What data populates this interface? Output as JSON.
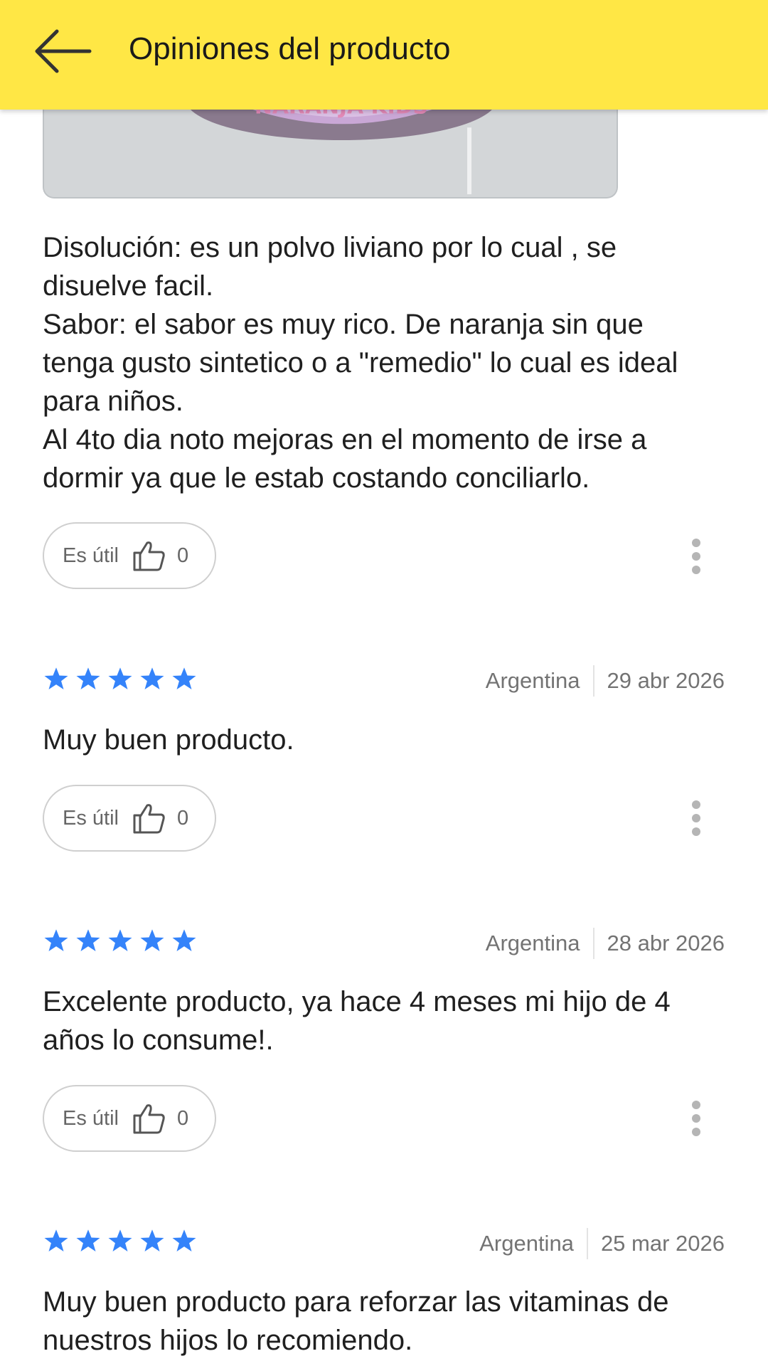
{
  "header": {
    "title": "Opiniones del producto",
    "back_icon": "arrow-left-icon"
  },
  "photo": {
    "label_text": "NARANJA KIDS"
  },
  "first_review": {
    "text": "Disolución: es un polvo liviano por lo cual , se\ndisuelve facil.\nSabor: el sabor es muy rico. De naranja sin que\ntenga gusto sintetico o a \"remedio\" lo cual es ideal\npara niños.\nAl 4to dia noto mejoras en el momento de irse a\ndormir ya que le estab costando conciliarlo.",
    "useful_label": "Es útil",
    "useful_count": "0"
  },
  "reviews": [
    {
      "rating": 5,
      "country": "Argentina",
      "date": "29 abr 2026",
      "text": "Muy buen producto.",
      "useful_label": "Es útil",
      "useful_count": "0"
    },
    {
      "rating": 5,
      "country": "Argentina",
      "date": "28 abr 2026",
      "text": "Excelente producto, ya hace 4 meses mi hijo de 4\naños lo consume!.",
      "useful_label": "Es útil",
      "useful_count": "0"
    },
    {
      "rating": 5,
      "country": "Argentina",
      "date": "25 mar 2026",
      "text": "Muy buen producto para reforzar las vitaminas de\nnuestros hijos lo recomiendo."
    }
  ],
  "colors": {
    "header_bg": "#ffe745",
    "star": "#3483fa",
    "text": "#1f1f1f",
    "muted": "#737373"
  }
}
